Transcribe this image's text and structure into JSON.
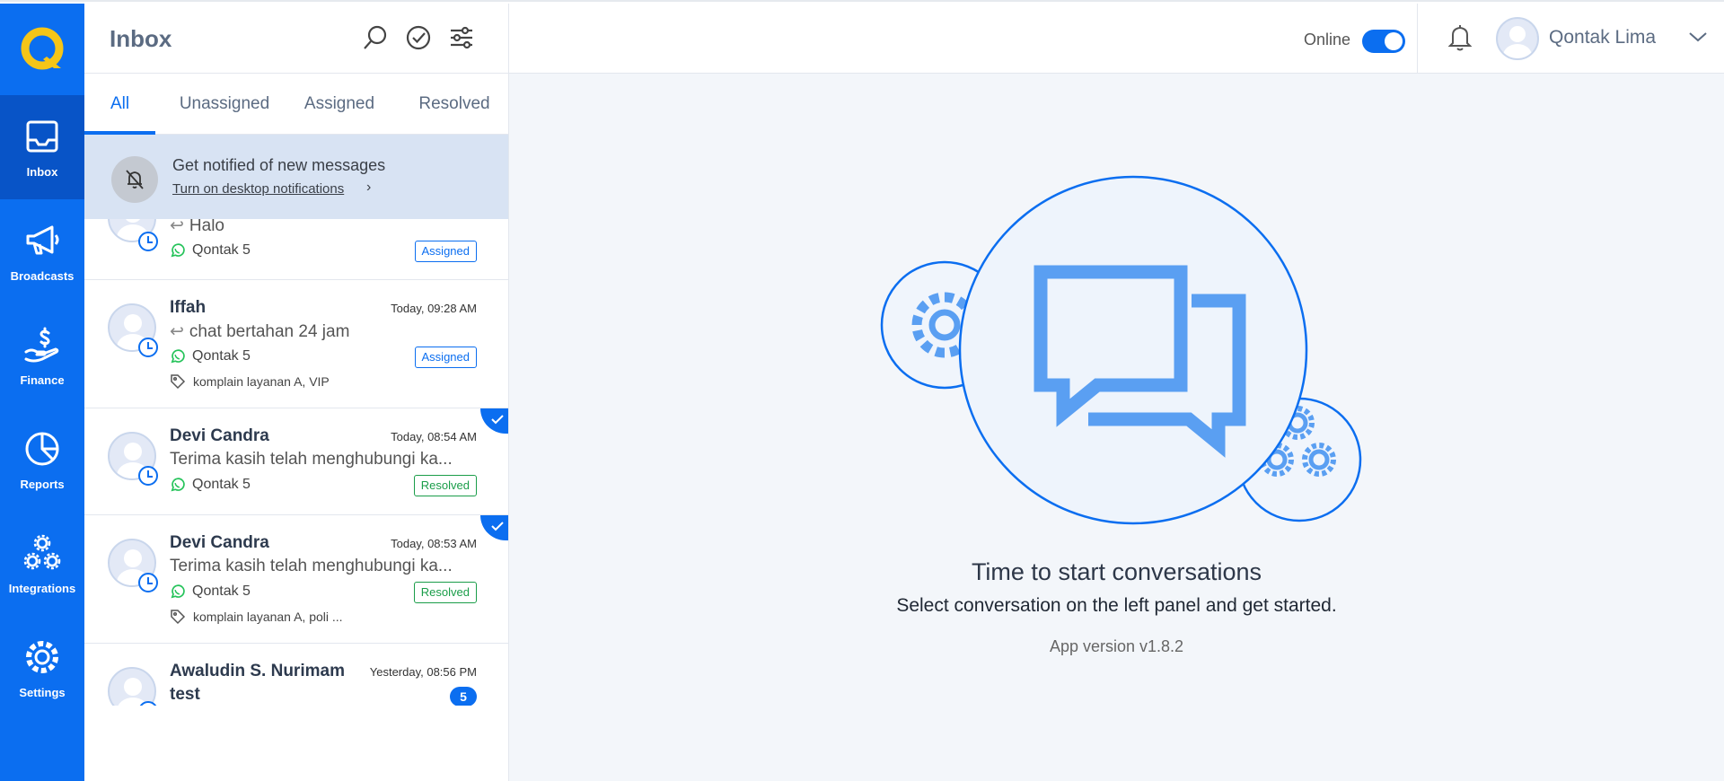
{
  "sidebar": {
    "items": [
      {
        "label": "Inbox",
        "icon": "inbox-icon",
        "active": true
      },
      {
        "label": "Broadcasts",
        "icon": "megaphone-icon"
      },
      {
        "label": "Finance",
        "icon": "finance-icon"
      },
      {
        "label": "Reports",
        "icon": "pie-chart-icon"
      },
      {
        "label": "Integrations",
        "icon": "integrations-icon"
      },
      {
        "label": "Settings",
        "icon": "gear-icon"
      }
    ]
  },
  "inbox": {
    "title": "Inbox",
    "tabs": [
      "All",
      "Unassigned",
      "Assigned",
      "Resolved"
    ],
    "active_tab": "All"
  },
  "notification": {
    "title": "Get notified of new messages",
    "link": "Turn on desktop notifications",
    "chevron": "›"
  },
  "conversations": [
    {
      "name": "",
      "time": "",
      "message": "Halo",
      "channel": "Qontak 5",
      "status": "Assigned"
    },
    {
      "name": "Iffah",
      "time": "Today, 09:28 AM",
      "message": "chat bertahan 24 jam",
      "channel": "Qontak 5",
      "status": "Assigned",
      "tags": "komplain layanan A, VIP"
    },
    {
      "name": "Devi Candra",
      "time": "Today, 08:54 AM",
      "message": "Terima kasih telah menghubungi ka...",
      "channel": "Qontak 5",
      "status": "Resolved"
    },
    {
      "name": "Devi Candra",
      "time": "Today, 08:53 AM",
      "message": "Terima kasih telah menghubungi ka...",
      "channel": "Qontak 5",
      "status": "Resolved",
      "tags": "komplain layanan A, poli ..."
    },
    {
      "name": "Awaludin S. Nurimam",
      "time": "Yesterday, 08:56 PM",
      "message": "test",
      "unread": "5"
    }
  ],
  "topbar": {
    "status_label": "Online",
    "status_on": true,
    "user_name": "Qontak Lima"
  },
  "main": {
    "title": "Time to start conversations",
    "subtitle": "Select conversation on the left panel and get started.",
    "version": "App version v1.8.2"
  },
  "colors": {
    "brand_blue": "#0b6ef0",
    "sidebar_active": "#0854c7",
    "resolved_green": "#1a9d49",
    "logo_yellow": "#f5c518"
  }
}
